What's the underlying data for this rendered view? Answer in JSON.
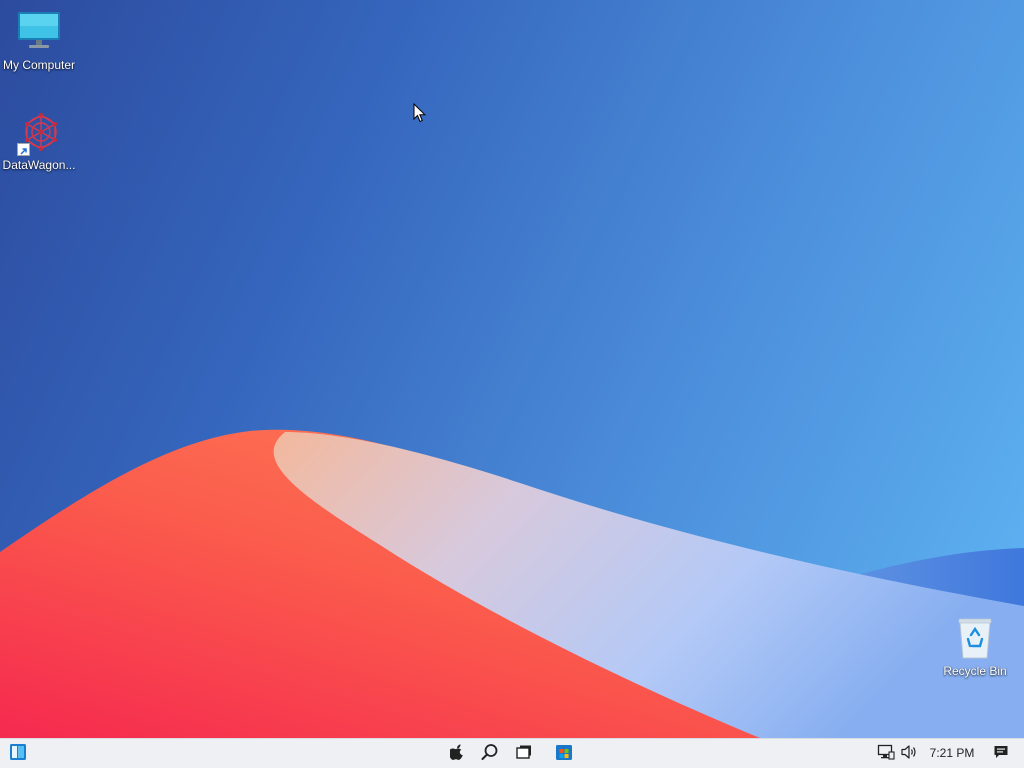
{
  "desktop": {
    "icons": [
      {
        "label": "My Computer",
        "icon": "monitor-icon"
      },
      {
        "label": "DataWagon...",
        "icon": "datawagon-app-icon",
        "shortcut": true
      },
      {
        "label": "Recycle Bin",
        "icon": "recycle-bin-icon"
      }
    ]
  },
  "taskbar": {
    "start_icon": "start-menu-icon",
    "pinned": [
      {
        "name": "apple-icon"
      },
      {
        "name": "search-icon"
      },
      {
        "name": "task-view-icon"
      },
      {
        "name": "store-icon"
      }
    ],
    "tray": {
      "network_icon": "network-icon",
      "volume_icon": "volume-icon",
      "clock": "7:21 PM",
      "notification_icon": "notification-icon"
    }
  },
  "colors": {
    "taskbar_bg": "#eef0f3",
    "accent": "#0078d4"
  }
}
